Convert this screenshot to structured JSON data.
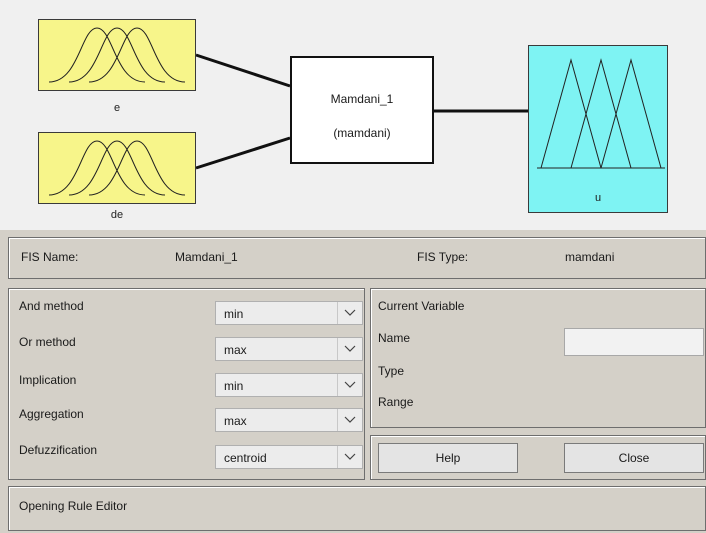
{
  "diagram": {
    "inputs": [
      {
        "name": "e"
      },
      {
        "name": "de"
      }
    ],
    "system": {
      "name": "Mamdani_1",
      "type": "(mamdani)"
    },
    "output": {
      "name": "u"
    },
    "colors": {
      "input_fill": "#f7f58a",
      "output_fill": "#7ef3f3",
      "background": "#f0f0f0"
    }
  },
  "fis": {
    "name_label": "FIS Name:",
    "name_value": "Mamdani_1",
    "type_label": "FIS Type:",
    "type_value": "mamdani"
  },
  "methods": [
    {
      "label": "And method",
      "value": "min"
    },
    {
      "label": "Or method",
      "value": "max"
    },
    {
      "label": "Implication",
      "value": "min"
    },
    {
      "label": "Aggregation",
      "value": "max"
    },
    {
      "label": "Defuzzification",
      "value": "centroid"
    }
  ],
  "current_variable": {
    "title": "Current Variable",
    "name_label": "Name",
    "name_value": "",
    "type_label": "Type",
    "range_label": "Range"
  },
  "buttons": {
    "help": "Help",
    "close": "Close"
  },
  "status": {
    "text": "Opening Rule Editor"
  }
}
